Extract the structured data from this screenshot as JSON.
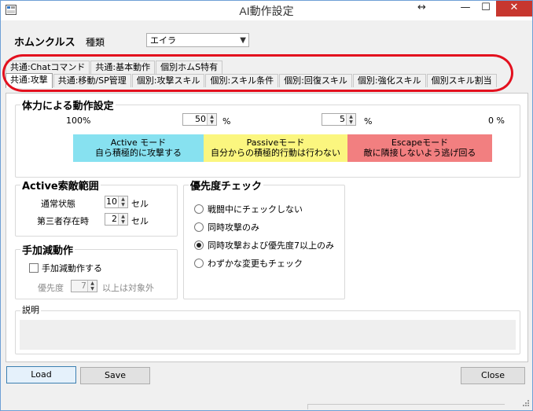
{
  "window": {
    "title": "AI動作設定"
  },
  "header": {
    "homunculus_label": "ホムンクルス",
    "kind_label": "種類",
    "kind_value": "エイラ"
  },
  "tabs_row1": [
    "共通:Chatコマンド",
    "共通:基本動作",
    "個別ホムS特有"
  ],
  "tabs_row2": [
    "共通:攻撃",
    "共通:移動/SP管理",
    "個別:攻撃スキル",
    "個別:スキル条件",
    "個別:回復スキル",
    "個別:強化スキル",
    "個別スキル割当"
  ],
  "active_tab": "共通:攻撃",
  "hp_group": {
    "title": "体力による動作設定",
    "left_pct": "100%",
    "spin1": "50",
    "pct1": "%",
    "spin2": "5",
    "pct2": "%",
    "right_pct": "0 %",
    "active_mode": {
      "line1": "Active モード",
      "line2": "自ら積極的に攻撃する",
      "color": "#87e1f0"
    },
    "passive_mode": {
      "line1": "Passiveモード",
      "line2": "自分からの積極的行動は行わない",
      "color": "#fbf67f"
    },
    "escape_mode": {
      "line1": "Escapeモード",
      "line2": "敵に隣接しないよう逃げ回る",
      "color": "#f27f80"
    }
  },
  "search_group": {
    "title": "Active索敵範囲",
    "normal_label": "通常状態",
    "normal_value": "10",
    "normal_unit": "セル",
    "third_label": "第三者存在時",
    "third_value": "2",
    "third_unit": "セル"
  },
  "manual_group": {
    "title": "手加減動作",
    "check_label": "手加減動作する",
    "checked": false,
    "priority_label": "優先度",
    "priority_value": "7",
    "priority_suffix": "以上は対象外"
  },
  "priority_group": {
    "title": "優先度チェック",
    "options": [
      "戦闘中にチェックしない",
      "同時攻撃のみ",
      "同時攻撃および優先度7以上のみ",
      "わずかな変更もチェック"
    ],
    "selected_index": 2
  },
  "description_group": {
    "title": "説明",
    "text": ""
  },
  "buttons": {
    "load": "Load",
    "save": "Save",
    "close": "Close"
  }
}
